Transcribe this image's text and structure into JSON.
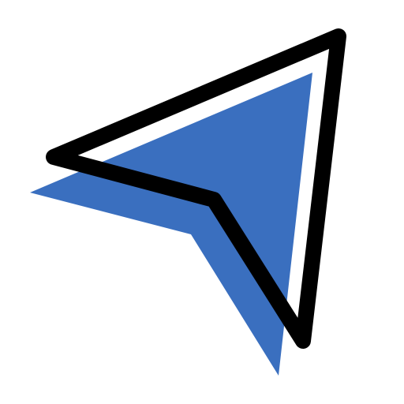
{
  "icon": {
    "name": "navigation-arrow-icon",
    "shadow_color": "#3A6FBF",
    "outline_color": "#000000",
    "background_color": "#FFFFFF"
  }
}
